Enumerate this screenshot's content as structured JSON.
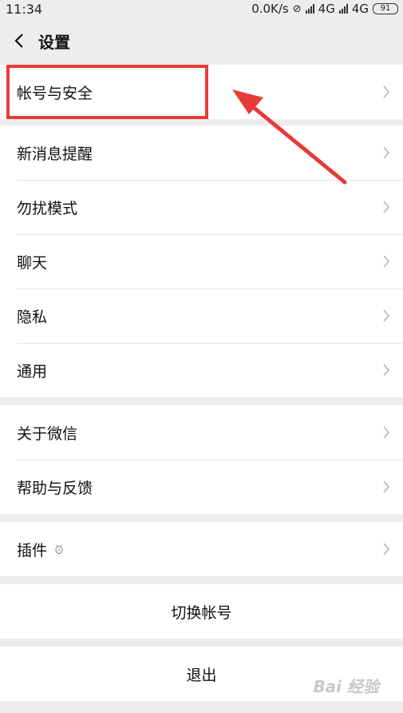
{
  "status": {
    "time": "11:34",
    "speed": "0.0K/s",
    "net1": "4G",
    "net2": "4G",
    "battery": "91"
  },
  "header": {
    "title": "设置"
  },
  "groups": [
    {
      "items": [
        {
          "label": "帐号与安全"
        }
      ]
    },
    {
      "items": [
        {
          "label": "新消息提醒"
        },
        {
          "label": "勿扰模式"
        },
        {
          "label": "聊天"
        },
        {
          "label": "隐私"
        },
        {
          "label": "通用"
        }
      ]
    },
    {
      "items": [
        {
          "label": "关于微信"
        },
        {
          "label": "帮助与反馈"
        }
      ]
    },
    {
      "items": [
        {
          "label": "插件"
        }
      ]
    }
  ],
  "actions": {
    "switch_account": "切换帐号",
    "logout": "退出"
  },
  "watermark": "Bai 经验",
  "colors": {
    "highlight": "#e83a3a",
    "arrow": "#e83a3a"
  },
  "icons": [
    "back-icon",
    "chevron-right-icon",
    "plugin-icon",
    "signal-icon",
    "battery-icon"
  ]
}
